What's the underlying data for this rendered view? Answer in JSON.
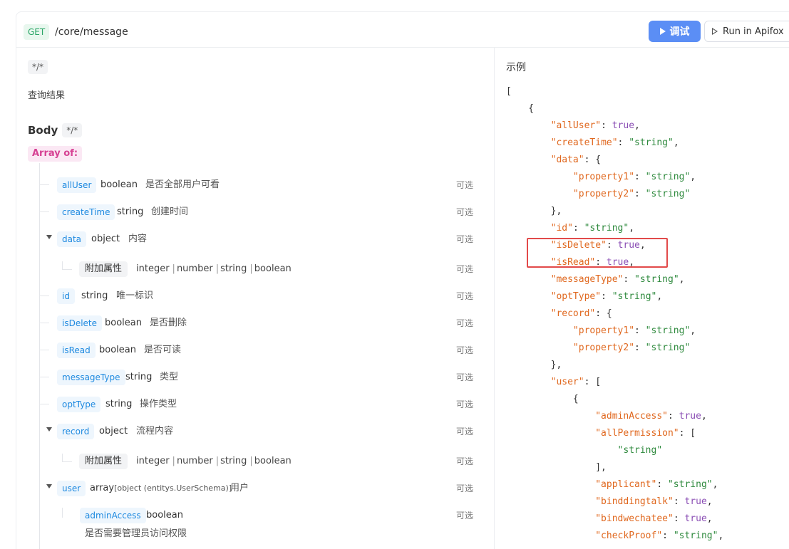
{
  "topbar": {
    "method": "GET",
    "path": "/core/message",
    "debug_label": "调试",
    "apifox_label": "Run in Apifox"
  },
  "left": {
    "media_tag": "*/*",
    "description": "查询结果",
    "body_title": "Body",
    "body_media": "*/*",
    "array_of": "Array of:",
    "optional_label": "可选",
    "fields": [
      {
        "name": "allUser",
        "type": "boolean",
        "desc": "是否全部用户可看"
      },
      {
        "name": "createTime",
        "type": "string",
        "desc": "创建时间"
      },
      {
        "name": "data",
        "type": "object",
        "desc": "内容"
      },
      {
        "name": "id",
        "type": "string",
        "desc": "唯一标识"
      },
      {
        "name": "isDelete",
        "type": "boolean",
        "desc": "是否删除"
      },
      {
        "name": "isRead",
        "type": "boolean",
        "desc": "是否可读"
      },
      {
        "name": "messageType",
        "type": "string",
        "desc": "类型"
      },
      {
        "name": "optType",
        "type": "string",
        "desc": "操作类型"
      },
      {
        "name": "record",
        "type": "object",
        "desc": "流程内容"
      },
      {
        "name": "user",
        "type": "array",
        "type_detail": "[object (entitys.UserSchema)]",
        "desc": "用户"
      }
    ],
    "additional_props": {
      "label": "附加属性",
      "types": [
        "integer",
        "number",
        "string",
        "boolean"
      ]
    },
    "user_children": [
      {
        "name": "adminAccess",
        "type": "boolean",
        "desc": "是否需要管理员访问权限"
      }
    ]
  },
  "right": {
    "title": "示例",
    "code_lines": [
      "[",
      "    {",
      "        \"allUser\": true,",
      "        \"createTime\": \"string\",",
      "        \"data\": {",
      "            \"property1\": \"string\",",
      "            \"property2\": \"string\"",
      "        },",
      "        \"id\": \"string\",",
      "        \"isDelete\": true,",
      "        \"isRead\": true,",
      "        \"messageType\": \"string\",",
      "        \"optType\": \"string\",",
      "        \"record\": {",
      "            \"property1\": \"string\",",
      "            \"property2\": \"string\"",
      "        },",
      "        \"user\": [",
      "            {",
      "                \"adminAccess\": true,",
      "                \"allPermission\": [",
      "                    \"string\"",
      "                ],",
      "                \"applicant\": \"string\",",
      "                \"binddingtalk\": true,",
      "                \"bindwechatee\": true,",
      "                \"checkProof\": \"string\","
    ],
    "highlight_color": "#e24a4a"
  },
  "colors": {
    "accent": "#5b8ef5",
    "field_tag": "#1f8ae0",
    "json_key": "#e0681f",
    "json_string": "#2f8a3e",
    "json_bool": "#8b4fb5",
    "array_of": "#d64193"
  }
}
